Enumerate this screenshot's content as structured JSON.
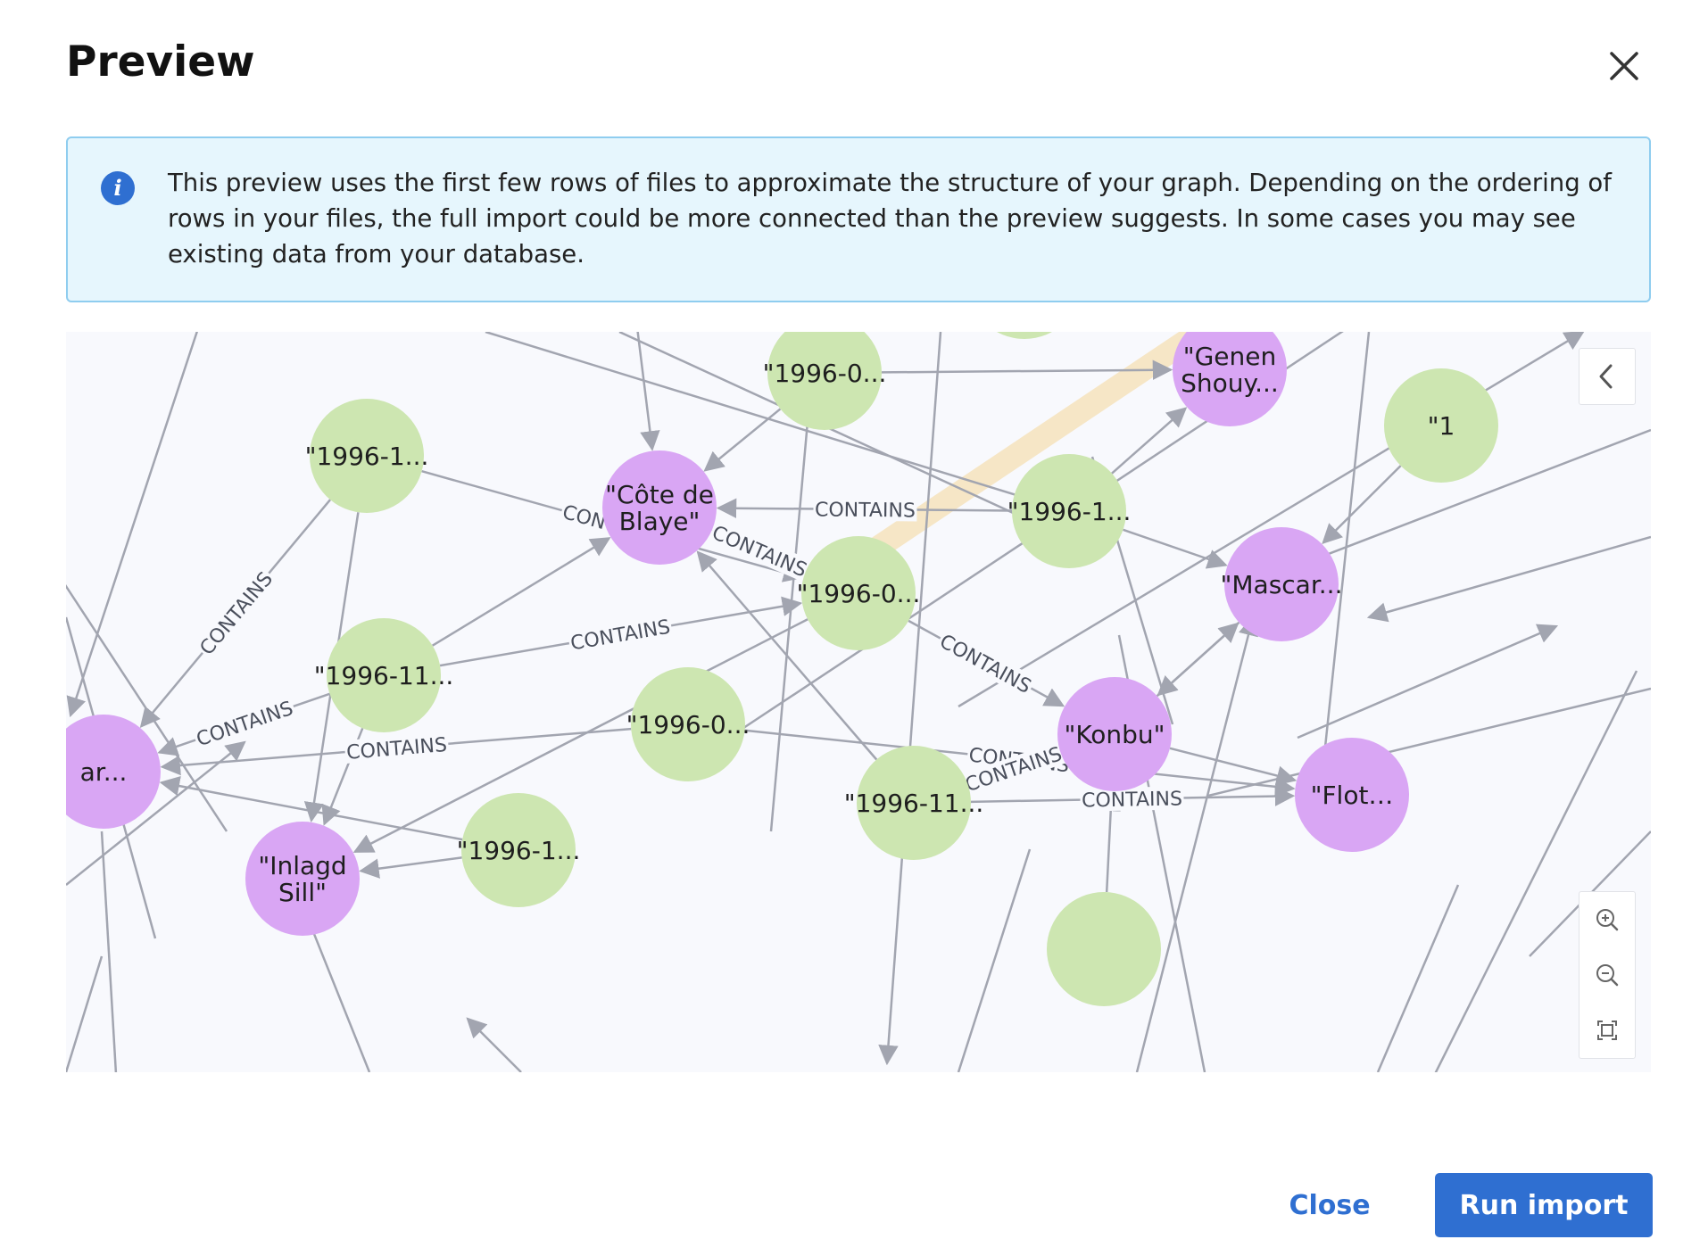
{
  "dialog": {
    "title": "Preview",
    "close_icon": "close-icon"
  },
  "info": {
    "icon": "info-icon",
    "icon_glyph": "i",
    "text": "This preview uses the first few rows of files to approximate the structure of your graph. Depending on the ordering of rows in your files, the full import could be more connected than the preview suggests. In some cases you may see existing data from your database."
  },
  "graph": {
    "relationship_label": "CONTAINS",
    "colors": {
      "date_node": "#cde6b1",
      "name_node": "#d9a6f4",
      "edge": "#a2a5b0",
      "highlight": "#f6e6c6",
      "background": "#f8f9fd"
    },
    "nodes": [
      {
        "id": "d1",
        "label": "\"1996-1...",
        "kind": "date"
      },
      {
        "id": "cote",
        "label": "\"Côte de\nBlaye\"",
        "kind": "name"
      },
      {
        "id": "d2",
        "label": "\"1996-0...",
        "kind": "date"
      },
      {
        "id": "genen",
        "label": "\"Genen\nShouy...",
        "kind": "name"
      },
      {
        "id": "d3",
        "label": "\"1996-1...",
        "kind": "date"
      },
      {
        "id": "d4",
        "label": "\"1996-0...",
        "kind": "date"
      },
      {
        "id": "mascar",
        "label": "\"Mascar...",
        "kind": "name"
      },
      {
        "id": "d5",
        "label": "\"1996-11...",
        "kind": "date"
      },
      {
        "id": "d6",
        "label": "\"1996-0...",
        "kind": "date"
      },
      {
        "id": "konbu",
        "label": "\"Konbu\"",
        "kind": "name"
      },
      {
        "id": "d7",
        "label": "\"1996-11...",
        "kind": "date"
      },
      {
        "id": "flot",
        "label": "\"Flot…",
        "kind": "name"
      },
      {
        "id": "inlagd",
        "label": "\"Inlagd\nSill\"",
        "kind": "name"
      },
      {
        "id": "d8",
        "label": "\"1996-1...",
        "kind": "date"
      },
      {
        "id": "mar",
        "label": "ar...",
        "kind": "name"
      },
      {
        "id": "edgeR",
        "label": "\"1",
        "kind": "date"
      },
      {
        "id": "b1",
        "label": "",
        "kind": "date"
      },
      {
        "id": "b2",
        "label": "",
        "kind": "date"
      },
      {
        "id": "b3",
        "label": "",
        "kind": "date"
      }
    ],
    "controls": {
      "collapse_icon": "chevron-left-icon",
      "zoom_in_icon": "zoom-in-icon",
      "zoom_out_icon": "zoom-out-icon",
      "fit_icon": "fit-screen-icon"
    }
  },
  "footer": {
    "close_label": "Close",
    "run_label": "Run import"
  }
}
